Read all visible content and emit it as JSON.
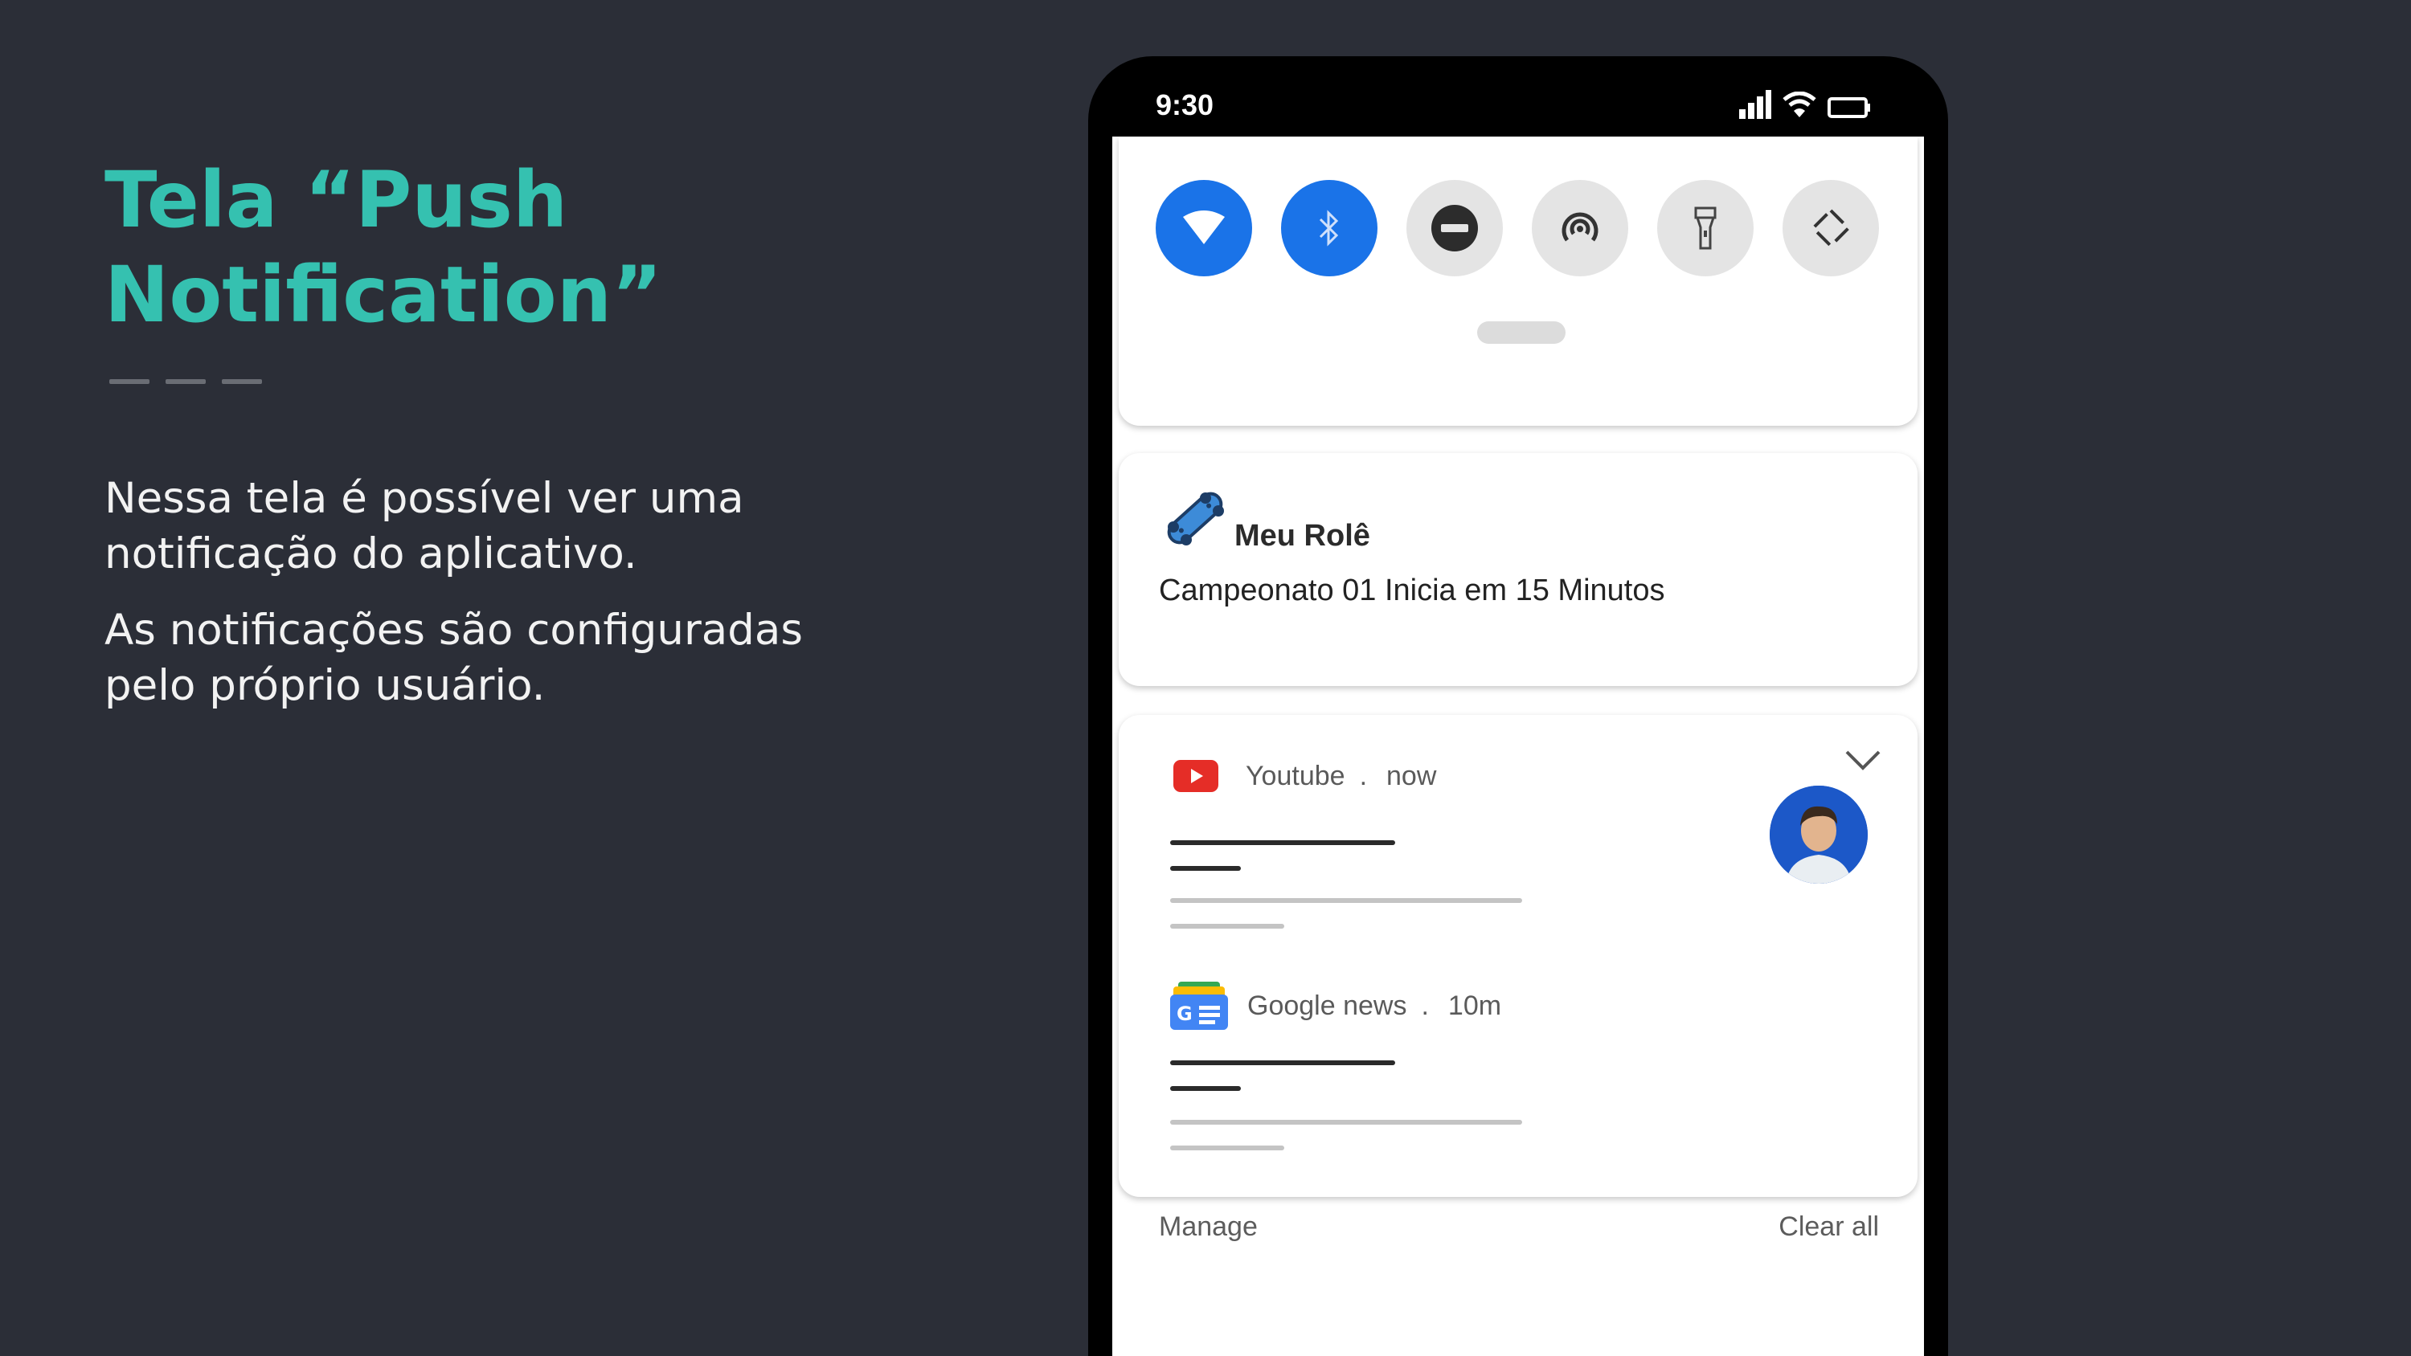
{
  "slide": {
    "title_line1": "Tela “Push",
    "title_line2": "Notification”",
    "desc1": "Nessa tela é possível ver uma notificação do aplicativo.",
    "desc2": "As notificações são configuradas pelo próprio usuário.",
    "accent_color": "#35c1b0"
  },
  "status_bar": {
    "time": "9:30",
    "icons": [
      "signal-icon",
      "wifi-icon",
      "battery-icon"
    ]
  },
  "quick_settings": {
    "tiles": [
      {
        "name": "wifi-tile",
        "icon": "wifi-icon",
        "active": true
      },
      {
        "name": "bluetooth-tile",
        "icon": "bluetooth-icon",
        "active": true
      },
      {
        "name": "dnd-tile",
        "icon": "do-not-disturb-icon",
        "active": false
      },
      {
        "name": "hotspot-tile",
        "icon": "hotspot-icon",
        "active": false
      },
      {
        "name": "flashlight-tile",
        "icon": "flashlight-icon",
        "active": false
      },
      {
        "name": "rotate-tile",
        "icon": "auto-rotate-icon",
        "active": false
      }
    ],
    "active_color": "#1a73e8"
  },
  "app_notification": {
    "app_name": "Meu Rolê",
    "message": "Campeonato 01 Inicia em 15 Minutos",
    "icon": "skateboard-icon"
  },
  "notifications": [
    {
      "app": "Youtube",
      "sep": ".",
      "time": "now",
      "icon": "youtube-icon"
    },
    {
      "app": "Google news",
      "sep": ".",
      "time": "10m",
      "icon": "google-news-icon"
    }
  ],
  "footer": {
    "manage": "Manage",
    "clear_all": "Clear all"
  }
}
